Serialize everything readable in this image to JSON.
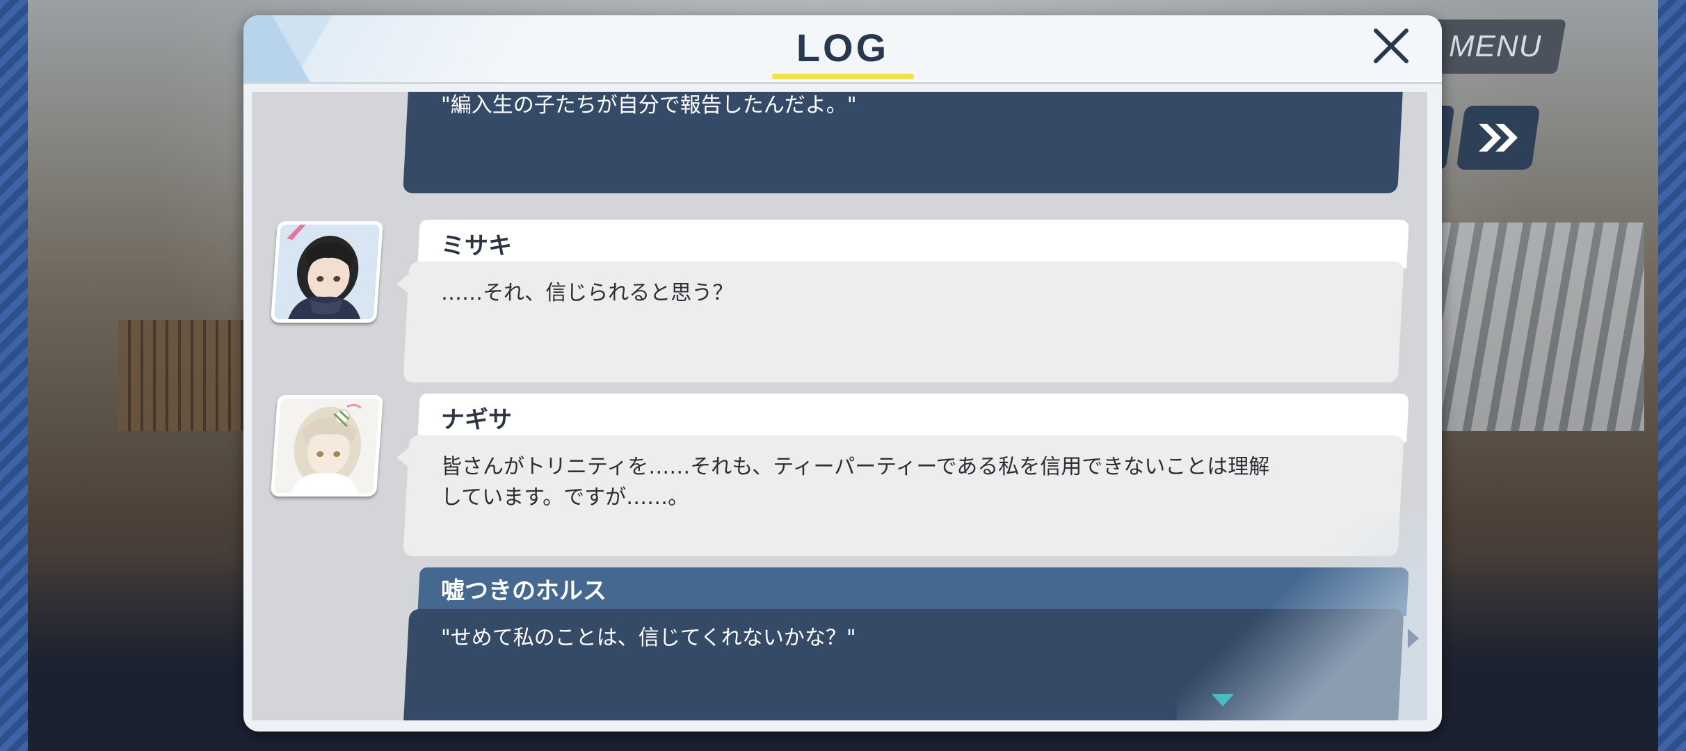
{
  "top_right": {
    "menu_label": "MENU",
    "fast_forward_icon": "double-chevron-right-icon"
  },
  "log": {
    "title": "LOG",
    "close_icon": "close-x-icon",
    "entries": [
      {
        "speaker": "",
        "text": "\"編入生の子たちが自分で報告したんだよ。\"",
        "style": "player"
      },
      {
        "speaker": "ミサキ",
        "text": "……それ、信じられると思う？",
        "style": "npc",
        "avatar": "misaki-portrait"
      },
      {
        "speaker": "ナギサ",
        "text": "皆さんがトリニティを……それも、ティーパーティーである私を信用できないことは理解しています。ですが……。",
        "style": "npc",
        "avatar": "nagisa-portrait"
      },
      {
        "speaker": "嘘つきのホルス",
        "text": "\"せめて私のことは、信じてくれないかな？\"",
        "style": "player"
      }
    ],
    "scroll_indicator_icon": "scroll-down-triangle-icon"
  },
  "colors": {
    "panel_bg": "#eef2f6",
    "title_underline": "#f4e04d",
    "player_name_bar": "#456891",
    "player_body": "#344a67",
    "npc_body": "#ededed"
  }
}
